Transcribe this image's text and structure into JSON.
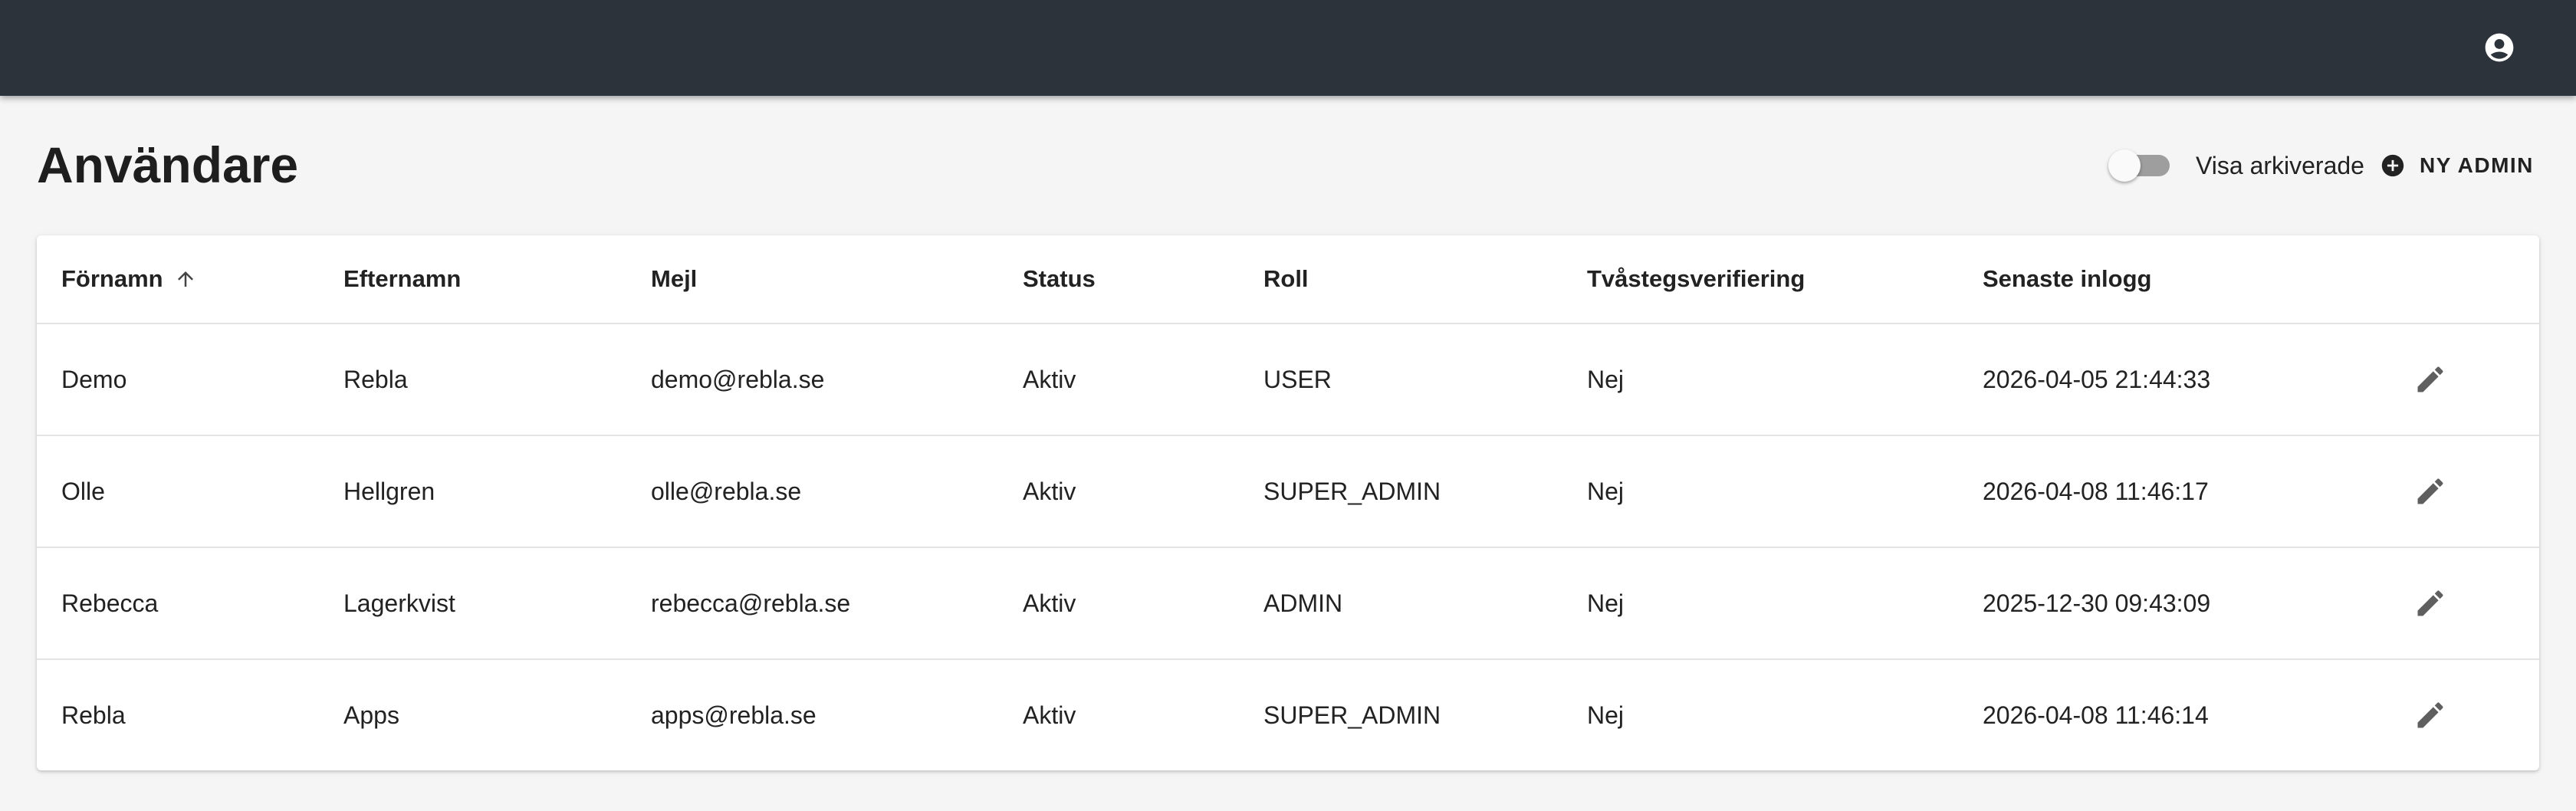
{
  "header": {
    "account_icon": "account-circle-icon"
  },
  "page": {
    "title": "Användare"
  },
  "controls": {
    "show_archived_label": "Visa arkiverade",
    "show_archived_checked": false,
    "new_admin_label": "NY ADMIN",
    "new_admin_icon": "add-circle-icon"
  },
  "table": {
    "columns": {
      "first_name": "Förnamn",
      "last_name": "Efternamn",
      "email": "Mejl",
      "status": "Status",
      "role": "Roll",
      "two_factor": "Tvåstegsverifiering",
      "last_login": "Senaste inlogg"
    },
    "sort": {
      "column": "first_name",
      "direction": "ascending",
      "icon": "arrow-up-icon"
    },
    "rows": [
      {
        "first_name": "Demo",
        "last_name": "Rebla",
        "email": "demo@rebla.se",
        "status": "Aktiv",
        "role": "USER",
        "two_factor": "Nej",
        "last_login": "2026-04-05 21:44:33"
      },
      {
        "first_name": "Olle",
        "last_name": "Hellgren",
        "email": "olle@rebla.se",
        "status": "Aktiv",
        "role": "SUPER_ADMIN",
        "two_factor": "Nej",
        "last_login": "2026-04-08 11:46:17"
      },
      {
        "first_name": "Rebecca",
        "last_name": "Lagerkvist",
        "email": "rebecca@rebla.se",
        "status": "Aktiv",
        "role": "ADMIN",
        "two_factor": "Nej",
        "last_login": "2025-12-30 09:43:09"
      },
      {
        "first_name": "Rebla",
        "last_name": "Apps",
        "email": "apps@rebla.se",
        "status": "Aktiv",
        "role": "SUPER_ADMIN",
        "two_factor": "Nej",
        "last_login": "2026-04-08 11:46:14"
      }
    ],
    "row_action_icon": "edit-pencil-icon"
  },
  "colors": {
    "topbar": "#2c333a",
    "background": "#f5f5f5",
    "card": "#ffffff",
    "icon": "#5f5f5f"
  }
}
